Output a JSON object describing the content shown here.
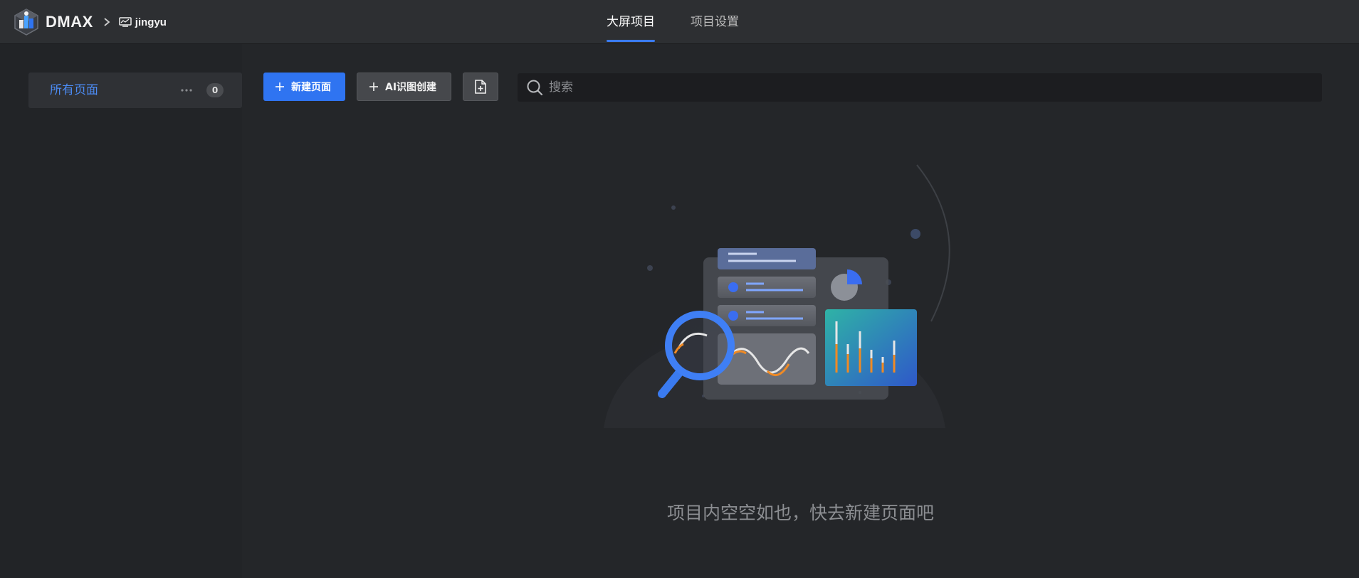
{
  "header": {
    "brand": "DMAX",
    "project_name": "jingyu",
    "tabs": [
      {
        "label": "大屏项目",
        "active": true
      },
      {
        "label": "项目设置",
        "active": false
      }
    ]
  },
  "sidebar": {
    "items": [
      {
        "label": "所有页面",
        "count": "0"
      }
    ]
  },
  "toolbar": {
    "new_page_label": "新建页面",
    "ai_create_label": "AI识图创建"
  },
  "search": {
    "placeholder": "搜索"
  },
  "empty_state": {
    "message": "项目内空空如也，快去新建页面吧"
  },
  "colors": {
    "accent": "#2f74f1",
    "active_text": "#4c8cf5",
    "background": "#242629",
    "topbar": "#2d2f32"
  }
}
